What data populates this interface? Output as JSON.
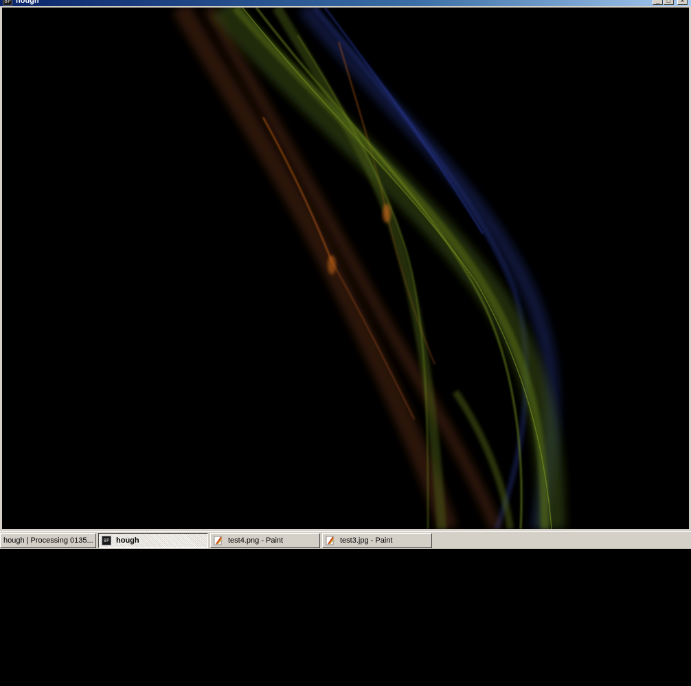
{
  "window": {
    "title": "hough",
    "icon": "processing-app-icon",
    "icon_text": "8P",
    "controls": {
      "minimize": "minimize-icon",
      "maximize": "maximize-icon",
      "close": "close-icon"
    }
  },
  "canvas": {
    "background": "#000000",
    "description_colors": {
      "green": "#6f8a1a",
      "orange": "#c8621a",
      "blue": "#2a3a8a"
    }
  },
  "taskbar": {
    "items": [
      {
        "label": "hough | Processing 0135...",
        "icon": "",
        "active": false
      },
      {
        "label": "hough",
        "icon": "processing-app-icon",
        "active": true
      },
      {
        "label": "test4.png - Paint",
        "icon": "paint-icon",
        "active": false
      },
      {
        "label": "test3.jpg - Paint",
        "icon": "paint-icon",
        "active": false
      }
    ]
  }
}
